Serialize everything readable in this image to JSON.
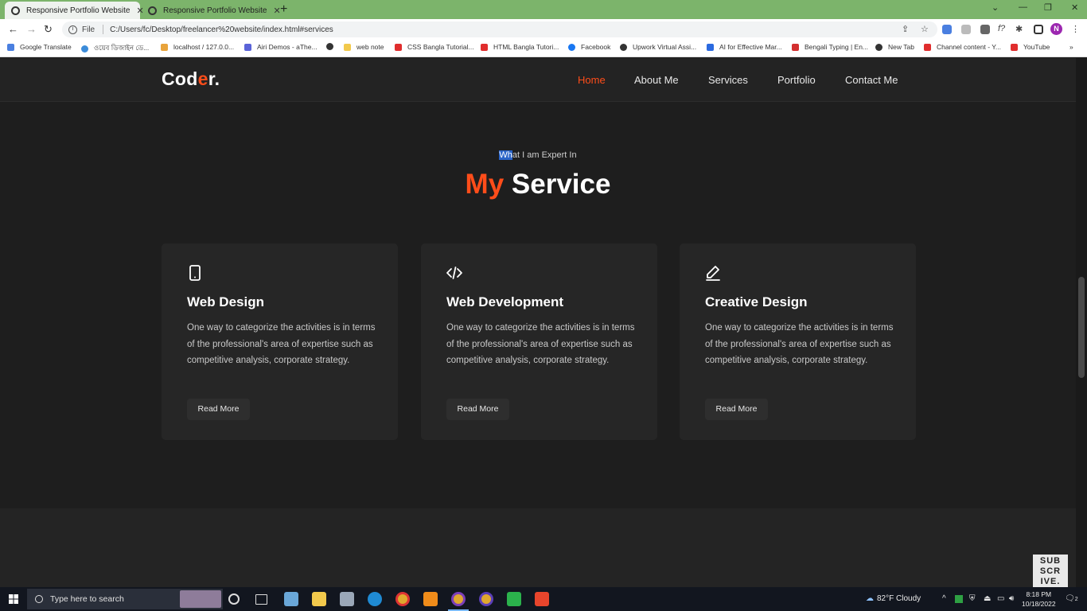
{
  "browser": {
    "tabs": [
      {
        "title": "Responsive Portfolio Website",
        "active": true
      },
      {
        "title": "Responsive Portfolio Website",
        "active": false
      }
    ],
    "url_scheme": "File",
    "url": "C:/Users/fc/Desktop/freelancer%20website/index.html#services",
    "profile_initial": "N",
    "bookmarks": [
      "Google Translate",
      "ওয়েব ডিজাইন ডে...",
      "localhost / 127.0.0...",
      "Airi Demos - aThe...",
      "",
      "web note",
      "CSS Bangla Tutorial...",
      "HTML Bangla Tutori...",
      "Facebook",
      "Upwork Virtual Assi...",
      "AI for Effective Mar...",
      "Bengali Typing | En...",
      "New Tab",
      "Channel content - Y...",
      "YouTube"
    ]
  },
  "site": {
    "logo_main": "Cod",
    "logo_accent": "e",
    "logo_tail": "r.",
    "nav": [
      "Home",
      "About Me",
      "Services",
      "Portfolio",
      "Contact Me"
    ],
    "active_nav": "Home",
    "accent_color": "#ff4d1a"
  },
  "services": {
    "subtitle_selected": "Wh",
    "subtitle_rest": "at I am Expert In",
    "heading_accent": "My",
    "heading_rest": " Service",
    "cards": [
      {
        "icon": "mobile-icon",
        "title": "Web Design",
        "description": "One way to categorize the activities is in terms of the professional's area of expertise such as competitive analysis, corporate strategy.",
        "button": "Read More"
      },
      {
        "icon": "code-icon",
        "title": "Web Development",
        "description": "One way to categorize the activities is in terms of the professional's area of expertise such as competitive analysis, corporate strategy.",
        "button": "Read More"
      },
      {
        "icon": "pen-icon",
        "title": "Creative Design",
        "description": "One way to categorize the activities is in terms of the professional's area of expertise such as competitive analysis, corporate strategy.",
        "button": "Read More"
      }
    ]
  },
  "overlay": {
    "subscribe": [
      "SUB",
      "SCR",
      "IVE."
    ]
  },
  "taskbar": {
    "search_placeholder": "Type here to search",
    "weather": "82°F  Cloudy",
    "time": "8:18 PM",
    "date": "10/18/2022",
    "notifications": "2"
  }
}
